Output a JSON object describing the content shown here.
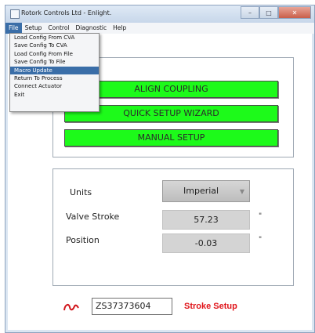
{
  "window": {
    "title": "Rotork Controls Ltd - Enlight.",
    "controls": {
      "minimize": "–",
      "maximize": "□",
      "close": "✕"
    }
  },
  "menubar": {
    "items": [
      {
        "label": "File",
        "active": true
      },
      {
        "label": "Setup"
      },
      {
        "label": "Control"
      },
      {
        "label": "Diagnostic"
      },
      {
        "label": "Help"
      }
    ]
  },
  "file_menu": {
    "items": [
      {
        "label": "Load Config From CVA"
      },
      {
        "label": "Save Config To CVA"
      },
      {
        "label": "Load Config From File"
      },
      {
        "label": "Save Config To File"
      },
      {
        "label": "Macro Update",
        "selected": true
      },
      {
        "label": "Return To Process"
      },
      {
        "label": "Connect Actuator"
      },
      {
        "label": "Exit"
      }
    ]
  },
  "actions": {
    "align_coupling": "ALIGN COUPLING",
    "quick_setup_wizard": "QUICK SETUP WIZARD",
    "manual_setup": "MANUAL SETUP"
  },
  "settings": {
    "units_label": "Units",
    "units_value": "Imperial",
    "valve_stroke_label": "Valve Stroke",
    "valve_stroke_value": "57.23",
    "valve_stroke_unit": "\"",
    "position_label": "Position",
    "position_value": "-0.03",
    "position_unit": "\""
  },
  "footer": {
    "serial": "ZS37373604",
    "status": "Stroke Setup"
  },
  "colors": {
    "action_button": "#1dfa1a",
    "status_text": "#e0141a",
    "menu_highlight": "#3a6ea8"
  }
}
